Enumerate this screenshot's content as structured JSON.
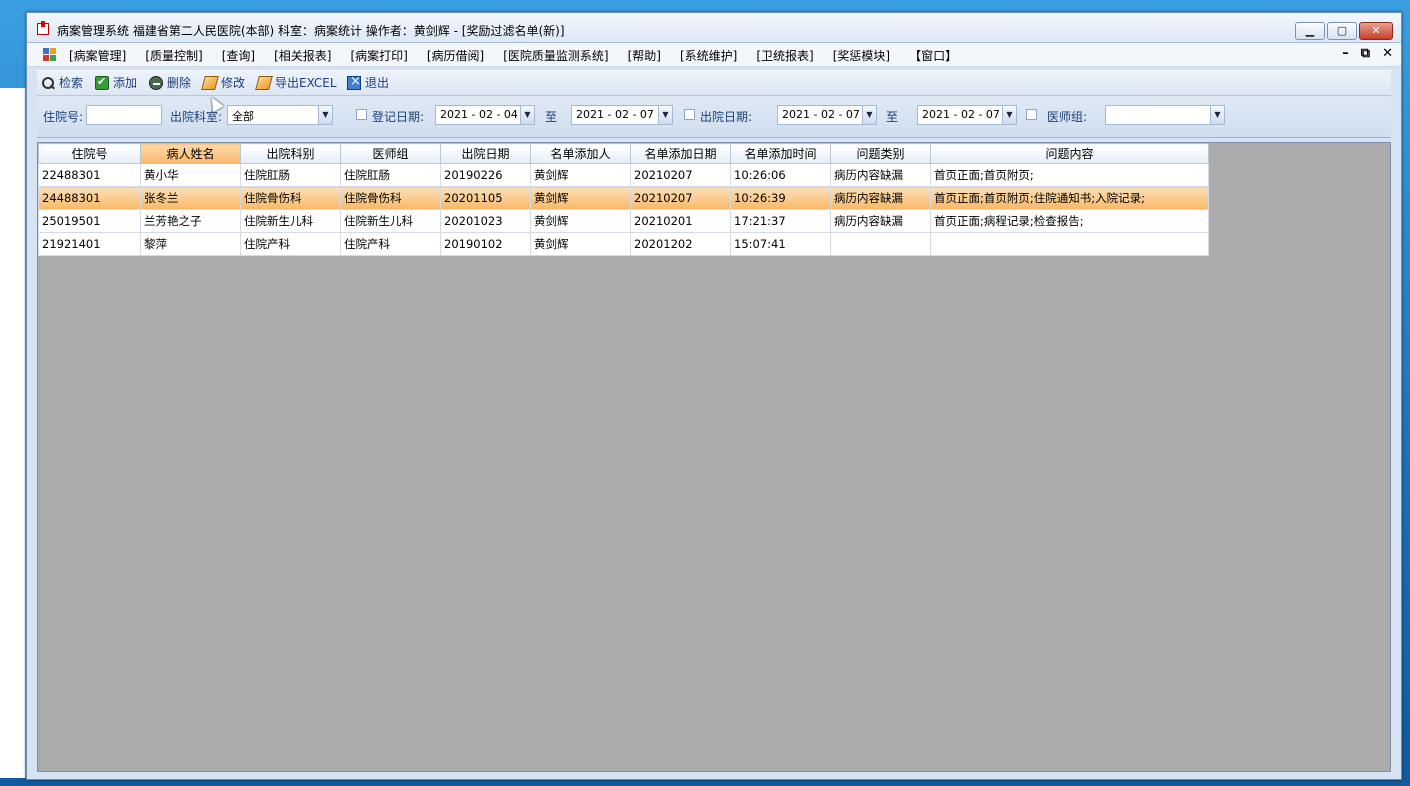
{
  "window": {
    "title": "病案管理系统  福建省第二人民医院(本部)  科室：病案统计  操作者：黄剑辉 - [奖励过滤名单(新)]"
  },
  "menu": {
    "items": [
      "[病案管理]",
      "[质量控制]",
      "[查询]",
      "[相关报表]",
      "[病案打印]",
      "[病历借阅]",
      "[医院质量监测系统]",
      "[帮助]",
      "[系统维护]",
      "[卫统报表]",
      "[奖惩模块]",
      "【窗口】"
    ]
  },
  "toolbar": {
    "search": "检索",
    "add": "添加",
    "delete": "删除",
    "edit": "修改",
    "export": "导出EXCEL",
    "exit": "退出"
  },
  "filter": {
    "inpatient_no_label": "住院号:",
    "inpatient_no_value": "",
    "discharge_dept_label": "出院科室:",
    "discharge_dept_value": "全部",
    "reg_date_label": "登记日期:",
    "reg_date_from": "2021 - 02 - 04",
    "to1": "至",
    "reg_date_to": "2021 - 02 - 07",
    "discharge_date_label": "出院日期:",
    "discharge_date_from": "2021 - 02 - 07",
    "to2": "至",
    "discharge_date_to": "2021 - 02 - 07",
    "doctor_group_label": "医师组:",
    "doctor_group_value": ""
  },
  "grid": {
    "columns": [
      "住院号",
      "病人姓名",
      "出院科别",
      "医师组",
      "出院日期",
      "名单添加人",
      "名单添加日期",
      "名单添加时间",
      "问题类别",
      "问题内容"
    ],
    "rows": [
      [
        "22488301",
        "黄小华",
        "住院肛肠",
        "住院肛肠",
        "20190226",
        "黄剑辉",
        "20210207",
        "10:26:06",
        "病历内容缺漏",
        "首页正面;首页附页;"
      ],
      [
        "24488301",
        "张冬兰",
        "住院骨伤科",
        "住院骨伤科",
        "20201105",
        "黄剑辉",
        "20210207",
        "10:26:39",
        "病历内容缺漏",
        "首页正面;首页附页;住院通知书;入院记录;"
      ],
      [
        "25019501",
        "兰芳艳之子",
        "住院新生儿科",
        "住院新生儿科",
        "20201023",
        "黄剑辉",
        "20210201",
        "17:21:37",
        "病历内容缺漏",
        "首页正面;病程记录;检查报告;"
      ],
      [
        "21921401",
        "黎萍",
        "住院产科",
        "住院产科",
        "20190102",
        "黄剑辉",
        "20201202",
        "15:07:41",
        "",
        ""
      ]
    ],
    "selected_row": 1,
    "selected_column": 1
  }
}
